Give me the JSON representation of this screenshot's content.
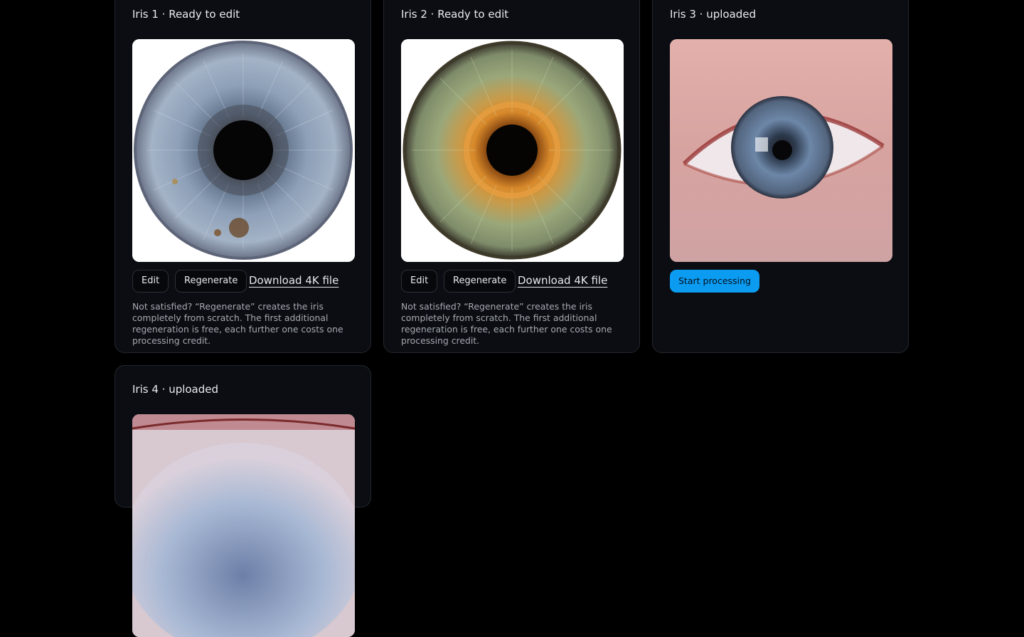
{
  "colors": {
    "background": "#000000",
    "card": "#0b0d12",
    "card_border": "#23262d",
    "primary_button": "#0b9cf2"
  },
  "cards": [
    {
      "title": "Iris 1 · Ready to edit",
      "image": "blue-grey iris render",
      "edit_label": "Edit",
      "regenerate_label": "Regenerate",
      "download_label": "Download 4K file",
      "note": "Not satisfied? “Regenerate” creates the iris completely from scratch. The first additional regeneration is free, each further one costs one processing credit."
    },
    {
      "title": "Iris 2 · Ready to edit",
      "image": "green-amber iris render",
      "edit_label": "Edit",
      "regenerate_label": "Regenerate",
      "download_label": "Download 4K file",
      "note": "Not satisfied? “Regenerate” creates the iris completely from scratch. The first additional regeneration is free, each further one costs one processing credit."
    },
    {
      "title": "Iris 3 · uploaded",
      "image": "uploaded eye photo",
      "action_label": "Start processing"
    },
    {
      "title": "Iris 4 · uploaded",
      "image": "uploaded eye photo (close-up)"
    }
  ]
}
